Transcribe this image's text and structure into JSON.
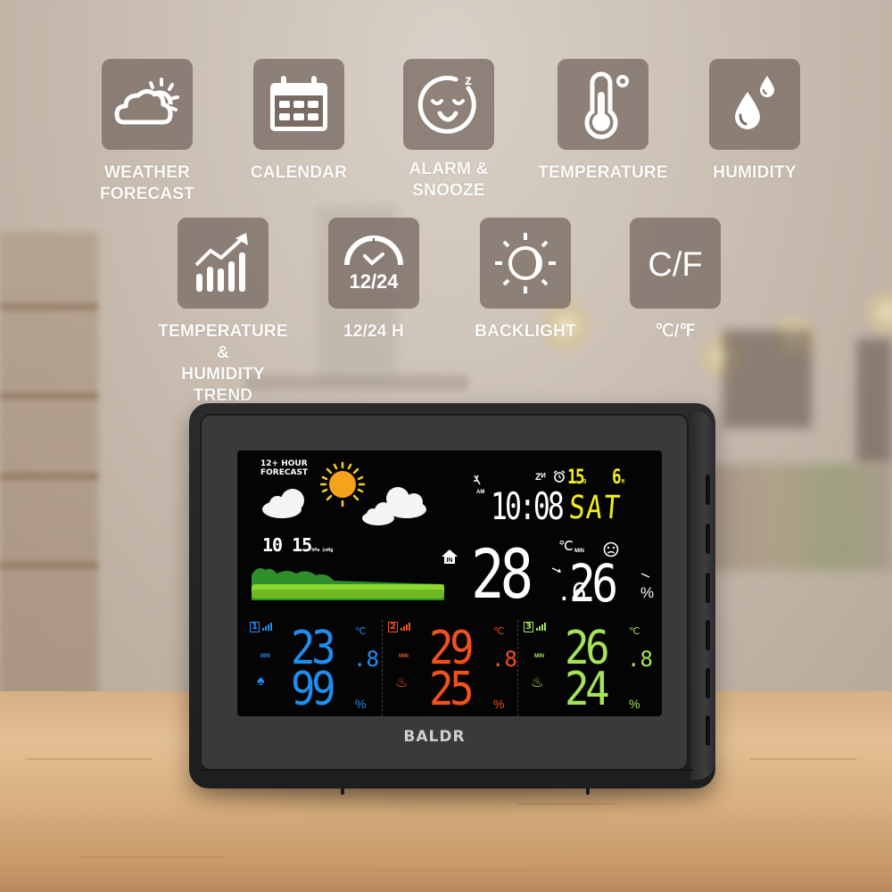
{
  "features": [
    {
      "icon": "weather-forecast-icon",
      "label_lines": [
        "WEATHER",
        "FORECAST"
      ]
    },
    {
      "icon": "calendar-icon",
      "label_lines": [
        "CALENDAR"
      ]
    },
    {
      "icon": "alarm-snooze-icon",
      "label_lines": [
        "ALARM &",
        "SNOOZE"
      ]
    },
    {
      "icon": "thermometer-icon",
      "label_lines": [
        "TEMPERATURE"
      ]
    },
    {
      "icon": "humidity-drops-icon",
      "label_lines": [
        "HUMIDITY"
      ]
    },
    {
      "icon": "trend-chart-icon",
      "label_lines": [
        "TEMPERATURE &",
        "HUMIDITY TREND"
      ]
    },
    {
      "icon": "clock-12-24-icon",
      "icon_text": "12/24",
      "label_lines": [
        "12/24 H"
      ]
    },
    {
      "icon": "backlight-icon",
      "label_lines": [
        "BACKLIGHT"
      ]
    },
    {
      "icon": "celsius-fahrenheit-icon",
      "icon_text": "C/F",
      "label_lines": [
        "℃/℉"
      ]
    }
  ],
  "device": {
    "brand": "BALDR",
    "display": {
      "forecast_title_lines": [
        "12+ HOUR",
        "FORECAST"
      ],
      "forecast_icon": "sun-with-clouds",
      "pressure": {
        "value": "10 15",
        "unit": "hPa inHg"
      },
      "am_label": "AM",
      "snooze_label": "Zᴻ",
      "time": "10:08",
      "date": {
        "day": "15",
        "day_suffix": "D",
        "month": "6",
        "month_suffix": "M"
      },
      "weekday": "SAT",
      "indoor": {
        "temperature": "28",
        "temperature_decimal": ".6",
        "temperature_unit": "℃",
        "min_label": "MIN",
        "humidity": "26",
        "humidity_unit": "%",
        "comfort": "uncomfortable-face"
      },
      "channels": [
        {
          "number": "1",
          "color": "#1f8ef0",
          "min_label": "MIN",
          "icon": "tree",
          "icon_glyph": "♠",
          "temperature": "23",
          "temperature_decimal": ".8",
          "temperature_unit": "℃",
          "humidity": "99",
          "humidity_unit": "%"
        },
        {
          "number": "2",
          "color": "#f2501c",
          "min_label": "MIN",
          "icon": "drops",
          "icon_glyph": "♨",
          "temperature": "29",
          "temperature_decimal": ".8",
          "temperature_unit": "℃",
          "humidity": "25",
          "humidity_unit": "%"
        },
        {
          "number": "3",
          "color": "#a6e35a",
          "min_label": "MIN",
          "icon": "drops",
          "icon_glyph": "♨",
          "temperature": "26",
          "temperature_decimal": ".8",
          "temperature_unit": "℃",
          "humidity": "24",
          "humidity_unit": "%"
        }
      ]
    }
  },
  "colors": {
    "tile": "#7a6c64",
    "lcd_yellow": "#f2ef1a",
    "lcd_white": "#ffffff"
  }
}
